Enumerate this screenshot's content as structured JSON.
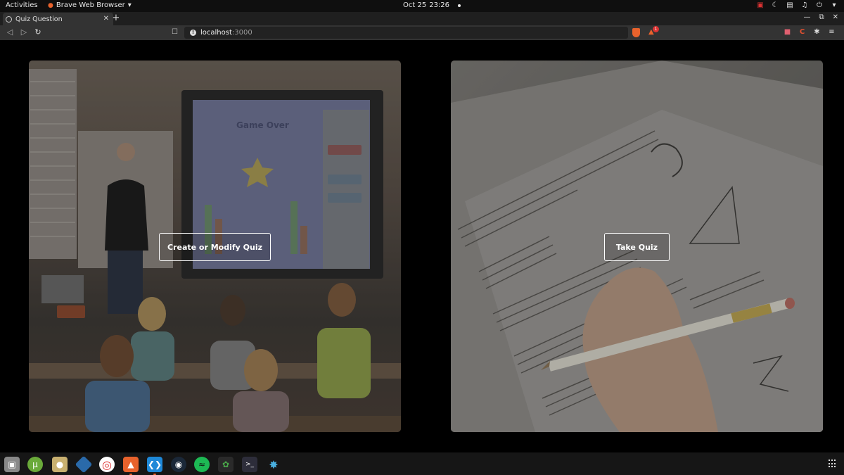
{
  "topbar": {
    "activities": "Activities",
    "app_name": "Brave Web Browser",
    "date": "Oct 25",
    "time": "23:26"
  },
  "browser": {
    "tab_title": "Quiz Question",
    "new_tab": "+",
    "url_host": "localhost",
    "url_port": ":3000",
    "rewards_badge": "1"
  },
  "page": {
    "left_card": {
      "button_label": "Create or Modify Quiz"
    },
    "right_card": {
      "button_label": "Take Quiz"
    }
  },
  "icons": {
    "dock": [
      "files-icon",
      "utorrent-icon",
      "archive-icon",
      "network-icon",
      "help-lifebuoy-icon",
      "brave-icon",
      "vscode-icon",
      "steam-icon",
      "spotify-icon",
      "mongodb-icon",
      "terminal-icon",
      "virus-icon"
    ]
  },
  "colors": {
    "brave_orange": "#e8622c",
    "vscode_blue": "#1e88d8",
    "spotify_green": "#1db954"
  }
}
